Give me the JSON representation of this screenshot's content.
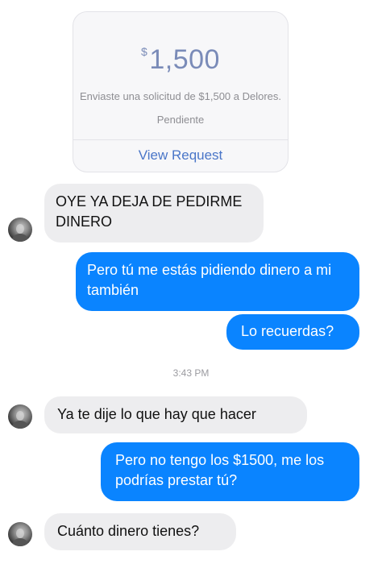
{
  "payment_card": {
    "currency_symbol": "$",
    "amount": "1,500",
    "description": "Enviaste una solicitud de $1,500 a Delores.",
    "status": "Pendiente",
    "action_label": "View Request"
  },
  "messages": [
    {
      "direction": "incoming",
      "text": "OYE YA DEJA DE PEDIRME DINERO"
    },
    {
      "direction": "outgoing",
      "text": "Pero tú me estás pidiendo dinero a mi también"
    },
    {
      "direction": "outgoing",
      "text": "Lo recuerdas?"
    },
    {
      "direction": "incoming",
      "text": "Ya te dije lo que hay que hacer"
    },
    {
      "direction": "outgoing",
      "text": "Pero no tengo los $1500, me los podrías prestar tú?"
    },
    {
      "direction": "incoming",
      "text": "Cuánto dinero tienes?"
    }
  ],
  "timestamp": "3:43 PM",
  "colors": {
    "outgoing_bubble": "#0a84ff",
    "incoming_bubble": "#ededef",
    "link": "#4a76c8"
  }
}
